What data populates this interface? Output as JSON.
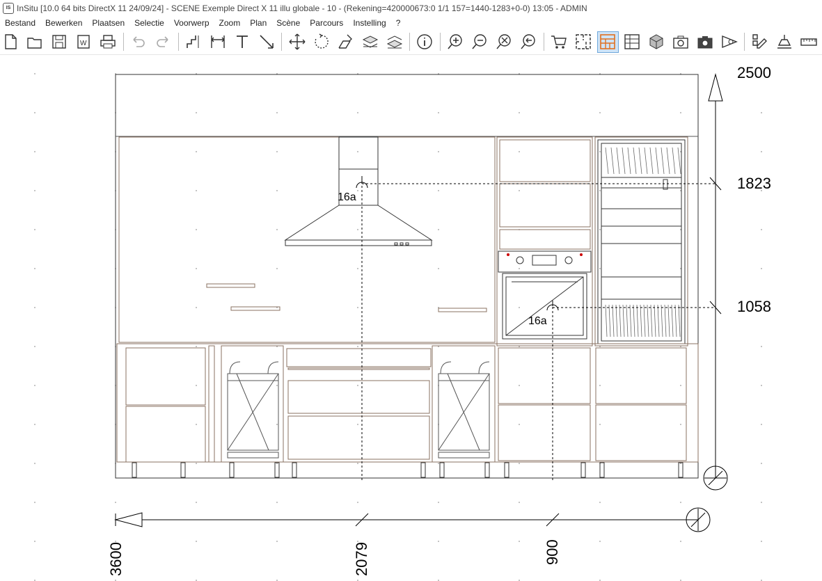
{
  "window": {
    "app_logo": "IS",
    "title": "InSitu [10.0 64 bits DirectX 11 24/09/24] - SCENE Exemple Direct X 11 illu globale - 10 - (Rekening=420000673:0 1/1 157=1440-1283+0-0) 13:05 - ADMIN"
  },
  "menu": [
    "Bestand",
    "Bewerken",
    "Plaatsen",
    "Selectie",
    "Voorwerp",
    "Zoom",
    "Plan",
    "Scène",
    "Parcours",
    "Instelling",
    "?"
  ],
  "toolbar": {
    "icons": [
      "new-file-icon",
      "open-folder-icon",
      "save-icon",
      "word-export-icon",
      "print-icon",
      "|",
      "undo-icon",
      "redo-icon",
      "|",
      "stair-dimension-icon",
      "width-dimension-icon",
      "text-icon",
      "arrow-icon",
      "|",
      "move-icon",
      "rotate-icon",
      "transform-icon",
      "layer-down-icon",
      "layer-up-icon",
      "|",
      "info-icon",
      "|",
      "zoom-in-icon",
      "zoom-out-icon",
      "zoom-fit-icon",
      "zoom-previous-icon",
      "|",
      "cart-icon",
      "plan-view-icon",
      "elevation-view-icon",
      "list-view-icon",
      "3d-box-icon",
      "camera-icon",
      "photo-icon",
      "eye-view-icon",
      "|",
      "properties-icon",
      "light-icon",
      "ruler-icon"
    ],
    "active": "elevation-view-icon",
    "accent": "#e07020"
  },
  "drawing": {
    "height_labels": [
      "2500",
      "1823",
      "1058"
    ],
    "width_labels": [
      "3600",
      "2079",
      "900"
    ],
    "item_labels": [
      "16a",
      "16a"
    ]
  }
}
